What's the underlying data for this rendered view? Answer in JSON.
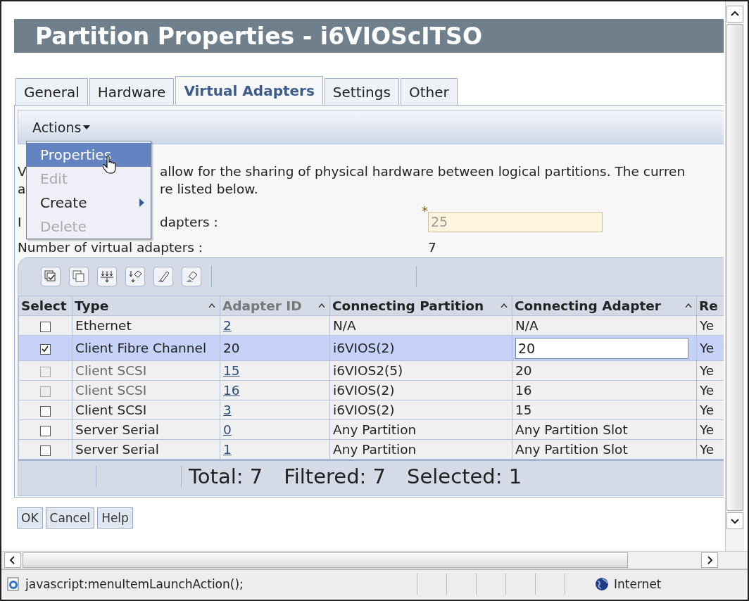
{
  "window": {
    "title": "Partition Properties - i6VIOScITSO"
  },
  "tabs": [
    {
      "label": "General",
      "selected": false
    },
    {
      "label": "Hardware",
      "selected": false
    },
    {
      "label": "Virtual Adapters",
      "selected": true
    },
    {
      "label": "Settings",
      "selected": false
    },
    {
      "label": "Other",
      "selected": false
    }
  ],
  "actions_menu": {
    "label": "Actions",
    "items": [
      {
        "label": "Properties",
        "selected": true,
        "disabled": false,
        "submenu": false
      },
      {
        "label": "Edit",
        "selected": false,
        "disabled": true,
        "submenu": false
      },
      {
        "label": "Create",
        "selected": false,
        "disabled": false,
        "submenu": true
      },
      {
        "label": "Delete",
        "selected": false,
        "disabled": true,
        "submenu": false
      }
    ]
  },
  "description_lines": [
    [
      "V",
      "allow for the sharing of physical hardware between logical partitions. The curren"
    ],
    [
      "a",
      "re listed below."
    ]
  ],
  "max_adapters": {
    "label_fragments": [
      "I",
      "dapters :"
    ],
    "required_mark": "*",
    "value": "25",
    "disabled": true
  },
  "adapter_count": {
    "label": "Number of virtual adapters :",
    "value": "7"
  },
  "table": {
    "columns": [
      {
        "label": "Select",
        "sortable": false,
        "dimmed": false
      },
      {
        "label": "Type",
        "sortable": true,
        "dimmed": false
      },
      {
        "label": "Adapter ID",
        "sortable": true,
        "dimmed": true
      },
      {
        "label": "Connecting Partition",
        "sortable": true,
        "dimmed": false
      },
      {
        "label": "Connecting Adapter",
        "sortable": true,
        "dimmed": false
      },
      {
        "label": "Re",
        "sortable": false,
        "dimmed": false
      }
    ],
    "rows": [
      {
        "selected": false,
        "disabled": false,
        "type": "Ethernet",
        "adapter_id": "2",
        "link": true,
        "partition": "N/A",
        "connecting_adapter": "N/A",
        "editing": false,
        "column_6": "Ye"
      },
      {
        "selected": true,
        "disabled": false,
        "type": "Client Fibre Channel",
        "adapter_id": "20",
        "link": false,
        "partition": "i6VIOS(2)",
        "connecting_adapter": "20",
        "editing": true,
        "column_6": "Ye"
      },
      {
        "selected": false,
        "disabled": true,
        "type": "Client SCSI",
        "adapter_id": "15",
        "link": true,
        "partition": "i6VIOS2(5)",
        "connecting_adapter": "20",
        "editing": false,
        "column_6": "Ye"
      },
      {
        "selected": false,
        "disabled": true,
        "type": "Client SCSI",
        "adapter_id": "16",
        "link": true,
        "partition": "i6VIOS(2)",
        "connecting_adapter": "16",
        "editing": false,
        "column_6": "Ye"
      },
      {
        "selected": false,
        "disabled": false,
        "type": "Client SCSI",
        "adapter_id": "3",
        "link": true,
        "partition": "i6VIOS(2)",
        "connecting_adapter": "15",
        "editing": false,
        "column_6": "Ye"
      },
      {
        "selected": false,
        "disabled": false,
        "type": "Server Serial",
        "adapter_id": "0",
        "link": true,
        "partition": "Any Partition",
        "connecting_adapter": "Any Partition Slot",
        "editing": false,
        "column_6": "Ye"
      },
      {
        "selected": false,
        "disabled": false,
        "type": "Server Serial",
        "adapter_id": "1",
        "link": true,
        "partition": "Any Partition",
        "connecting_adapter": "Any Partition Slot",
        "editing": false,
        "column_6": "Ye"
      }
    ],
    "footer": [
      "Total: 7",
      "Filtered: 7",
      "Selected: 1"
    ]
  },
  "buttons": [
    "OK",
    "Cancel",
    "Help"
  ],
  "status_bar": {
    "text": "javascript:menuItemLaunchAction();",
    "zone": "Internet"
  }
}
